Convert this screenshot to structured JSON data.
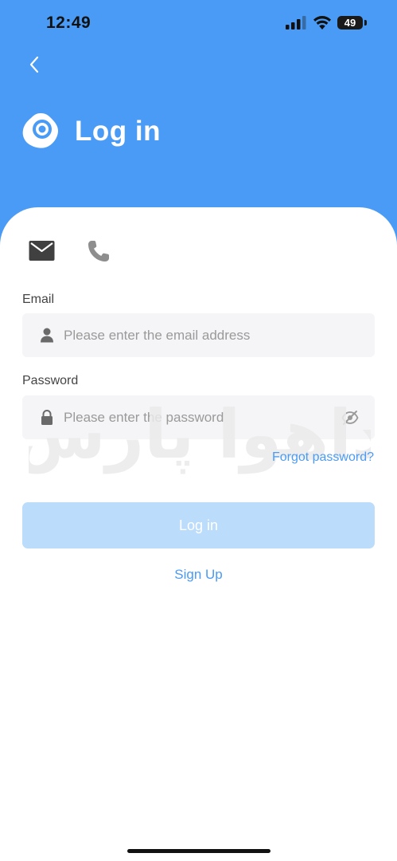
{
  "status_bar": {
    "time": "12:49",
    "battery_level": "49",
    "icons": [
      "signal-icon",
      "wifi-icon",
      "battery-icon"
    ]
  },
  "header": {
    "title": "Log in",
    "back_icon": "chevron-left-icon",
    "logo_icon": "camera-eye-logo-icon"
  },
  "tabs": [
    {
      "icon": "mail-icon",
      "selected": true
    },
    {
      "icon": "phone-icon",
      "selected": false
    }
  ],
  "email": {
    "label": "Email",
    "icon": "person-icon",
    "placeholder": "Please enter the email address",
    "value": ""
  },
  "password": {
    "label": "Password",
    "icon": "lock-icon",
    "placeholder": "Please enter the password",
    "value": "",
    "toggle_icon": "eye-off-icon"
  },
  "actions": {
    "forgot_password": "Forgot password?",
    "login_button": "Log in",
    "sign_up": "Sign Up"
  },
  "watermark": {
    "text": "داهوا پارس"
  },
  "colors": {
    "primary": "#4a9bf5",
    "button_disabled": "#bcdcfb",
    "input_bg": "#f5f5f7",
    "card_bg": "#ffffff",
    "label_text": "#444444",
    "placeholder_text": "#9a9a9a"
  }
}
